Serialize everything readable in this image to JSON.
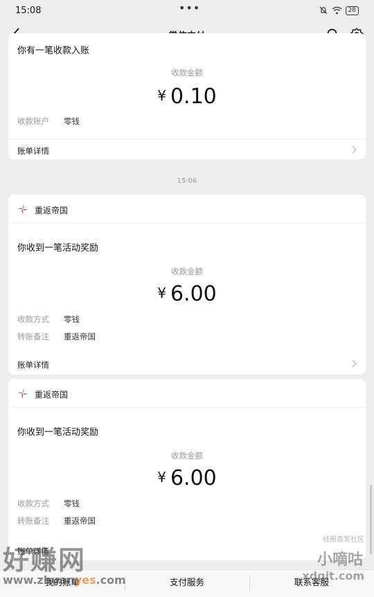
{
  "status_bar": {
    "time": "15:08",
    "dots": "•••",
    "battery": "28"
  },
  "nav": {
    "title": "微信支付"
  },
  "cards": [
    {
      "message_title": "你有一笔收款入账",
      "amount_label": "收款金额",
      "currency": "¥",
      "amount": "0.10",
      "rows": [
        {
          "label": "收款账户",
          "value": "零钱"
        }
      ],
      "detail_label": "账单详情"
    },
    {
      "brand": "重返帝国",
      "message_title": "你收到一笔活动奖励",
      "amount_label": "收款金额",
      "currency": "¥",
      "amount": "6.00",
      "rows": [
        {
          "label": "收款方式",
          "value": "零钱"
        },
        {
          "label": "转账备注",
          "value": "重返帝国"
        }
      ],
      "detail_label": "账单详情"
    },
    {
      "brand": "重返帝国",
      "message_title": "你收到一笔活动奖励",
      "amount_label": "收款金额",
      "currency": "¥",
      "amount": "6.00",
      "rows": [
        {
          "label": "收款方式",
          "value": "零钱"
        },
        {
          "label": "转账备注",
          "value": "重返帝国"
        }
      ],
      "detail_label": "账单详情"
    }
  ],
  "time_separator": "15:06",
  "bottom_bar": {
    "left": "我的账单",
    "center": "支付服务",
    "right": "联系客服"
  },
  "watermarks": {
    "left_big": "好赚网",
    "left_url_prefix": "www.zhuan",
    "left_url_accent": "yes",
    "left_url_suffix": ".com",
    "right_top": "线报首发社区",
    "right_mid": "小嘀咕",
    "right_bot": "xdgit.com"
  }
}
